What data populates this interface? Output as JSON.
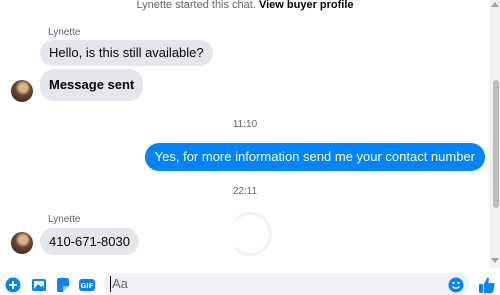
{
  "banner": {
    "text": "Lynette started this chat.",
    "link": "View buyer profile"
  },
  "messages": {
    "sender1": "Lynette",
    "m1": "Hello, is this still available?",
    "m2": "Message sent",
    "time1": "11:10",
    "m3": "Yes, for more information send me your contact number",
    "time2": "22:11",
    "sender2": "Lynette",
    "m4": "410-671-8030"
  },
  "composer": {
    "placeholder": "Aa",
    "icons": [
      "plus-circle-icon",
      "image-icon",
      "sticker-icon",
      "gif-icon",
      "emoji-icon",
      "thumbs-up-icon"
    ]
  },
  "colors": {
    "accent": "#0084ff",
    "incoming_bubble": "#e4e6eb",
    "secondary_text": "#65676b"
  }
}
